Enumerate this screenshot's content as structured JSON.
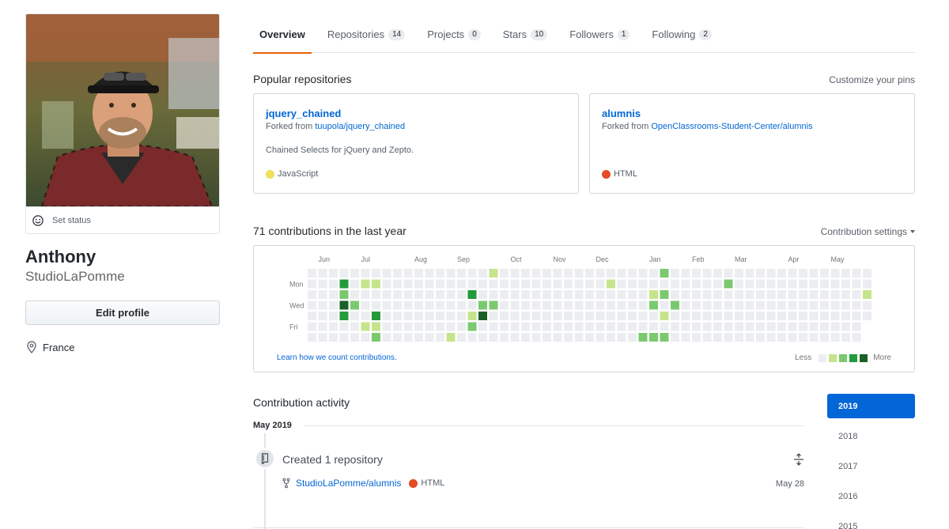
{
  "profile": {
    "full_name": "Anthony",
    "username": "StudioLaPomme",
    "set_status_label": "Set status",
    "edit_profile_label": "Edit profile",
    "location": "France",
    "avatar_icon": "profile-photo"
  },
  "tabs": [
    {
      "label": "Overview",
      "count": null,
      "selected": true
    },
    {
      "label": "Repositories",
      "count": "14",
      "selected": false
    },
    {
      "label": "Projects",
      "count": "0",
      "selected": false
    },
    {
      "label": "Stars",
      "count": "10",
      "selected": false
    },
    {
      "label": "Followers",
      "count": "1",
      "selected": false
    },
    {
      "label": "Following",
      "count": "2",
      "selected": false
    }
  ],
  "popular": {
    "title": "Popular repositories",
    "customize_label": "Customize your pins",
    "repos": [
      {
        "name": "jquery_chained",
        "forked_prefix": "Forked from ",
        "forked_from": "tuupola/jquery_chained",
        "description": "Chained Selects for jQuery and Zepto.",
        "language": "JavaScript",
        "language_color": "#f1e05a"
      },
      {
        "name": "alumnis",
        "forked_prefix": "Forked from ",
        "forked_from": "OpenClassrooms-Student-Center/alumnis",
        "description": "",
        "language": "HTML",
        "language_color": "#e34c26"
      }
    ]
  },
  "contributions": {
    "title": "71 contributions in the last year",
    "settings_label": "Contribution settings",
    "learn_label": "Learn how we count contributions.",
    "legend_less": "Less",
    "legend_more": "More",
    "legend_colors": [
      "#ebedf0",
      "#c6e48b",
      "#7bc96f",
      "#239a3b",
      "#196127"
    ],
    "months": [
      {
        "label": "Jun",
        "week": 1
      },
      {
        "label": "Jul",
        "week": 5
      },
      {
        "label": "Aug",
        "week": 10
      },
      {
        "label": "Sep",
        "week": 14
      },
      {
        "label": "Oct",
        "week": 19
      },
      {
        "label": "Nov",
        "week": 23
      },
      {
        "label": "Dec",
        "week": 27
      },
      {
        "label": "Jan",
        "week": 32
      },
      {
        "label": "Feb",
        "week": 36
      },
      {
        "label": "Mar",
        "week": 40
      },
      {
        "label": "Apr",
        "week": 45
      },
      {
        "label": "May",
        "week": 49
      }
    ],
    "day_labels": [
      {
        "label": "Mon",
        "day": 1
      },
      {
        "label": "Wed",
        "day": 3
      },
      {
        "label": "Fri",
        "day": 5
      }
    ],
    "weeks": 53,
    "last_week_days": 5,
    "active_cells": [
      {
        "week": 0,
        "day": 6,
        "level": 0
      },
      {
        "week": 3,
        "day": 1,
        "level": 3
      },
      {
        "week": 3,
        "day": 2,
        "level": 2
      },
      {
        "week": 3,
        "day": 3,
        "level": 4
      },
      {
        "week": 3,
        "day": 4,
        "level": 3
      },
      {
        "week": 4,
        "day": 3,
        "level": 2
      },
      {
        "week": 5,
        "day": 1,
        "level": 1
      },
      {
        "week": 5,
        "day": 5,
        "level": 1
      },
      {
        "week": 6,
        "day": 1,
        "level": 1
      },
      {
        "week": 6,
        "day": 4,
        "level": 3
      },
      {
        "week": 6,
        "day": 5,
        "level": 1
      },
      {
        "week": 6,
        "day": 6,
        "level": 2
      },
      {
        "week": 13,
        "day": 6,
        "level": 1
      },
      {
        "week": 15,
        "day": 2,
        "level": 3
      },
      {
        "week": 15,
        "day": 4,
        "level": 1
      },
      {
        "week": 15,
        "day": 5,
        "level": 2
      },
      {
        "week": 16,
        "day": 3,
        "level": 2
      },
      {
        "week": 16,
        "day": 4,
        "level": 4
      },
      {
        "week": 17,
        "day": 0,
        "level": 1
      },
      {
        "week": 17,
        "day": 3,
        "level": 2
      },
      {
        "week": 28,
        "day": 1,
        "level": 1
      },
      {
        "week": 31,
        "day": 6,
        "level": 2
      },
      {
        "week": 32,
        "day": 2,
        "level": 1
      },
      {
        "week": 32,
        "day": 3,
        "level": 2
      },
      {
        "week": 32,
        "day": 6,
        "level": 2
      },
      {
        "week": 33,
        "day": 0,
        "level": 2
      },
      {
        "week": 33,
        "day": 2,
        "level": 2
      },
      {
        "week": 33,
        "day": 4,
        "level": 1
      },
      {
        "week": 33,
        "day": 6,
        "level": 2
      },
      {
        "week": 34,
        "day": 3,
        "level": 2
      },
      {
        "week": 39,
        "day": 1,
        "level": 2
      },
      {
        "week": 52,
        "day": 2,
        "level": 1
      }
    ]
  },
  "activity": {
    "title": "Contribution activity",
    "month": "May 2019",
    "created_text": "Created 1 repository",
    "item_repo": "StudioLaPomme/alumnis",
    "item_language": "HTML",
    "item_language_color": "#e34c26",
    "item_date": "May 28"
  },
  "years": [
    {
      "label": "2019",
      "selected": true
    },
    {
      "label": "2018",
      "selected": false
    },
    {
      "label": "2017",
      "selected": false
    },
    {
      "label": "2016",
      "selected": false
    },
    {
      "label": "2015",
      "selected": false
    }
  ]
}
